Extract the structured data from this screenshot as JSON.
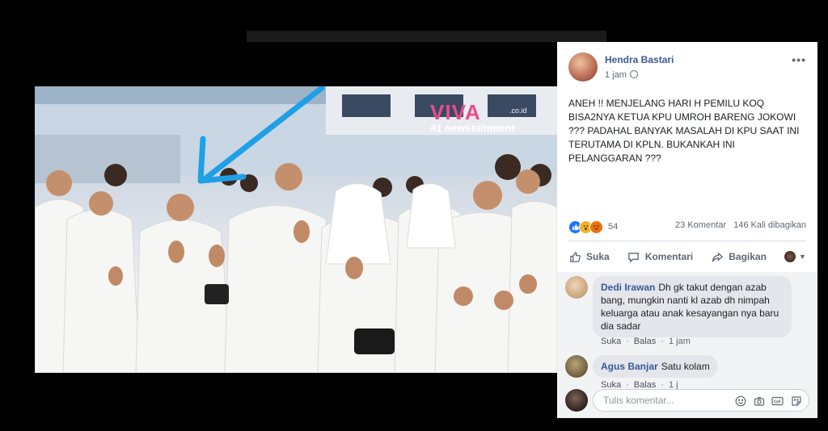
{
  "photo": {
    "watermark_logo": "VIVA",
    "watermark_domain": ".co.id",
    "watermark_tag": "#1 newstainment"
  },
  "post": {
    "author": "Hendra Bastari",
    "time": "1 jam",
    "more_label": "•••",
    "text": "ANEH !! MENJELANG HARI H PEMILU KOQ BISA2NYA KETUA KPU UMROH BARENG JOKOWI ??? PADAHAL BANYAK MASALAH DI KPU SAAT INI TERUTAMA DI KPLN. BUKANKAH INI PELANGGARAN ???",
    "reaction_count": "54",
    "comments_count": "23 Komentar",
    "shares_count": "146 Kali dibagikan"
  },
  "actions": {
    "like": "Suka",
    "comment": "Komentari",
    "share": "Bagikan"
  },
  "comments": [
    {
      "author": "Dedi Irawan",
      "text": "Dh gk takut dengan azab bang, mungkin nanti kl azab dh nimpah keluarga atau anak kesayangan nya baru dia sadar",
      "like": "Suka",
      "reply": "Balas",
      "time": "1 jam"
    },
    {
      "author": "Agus Banjar",
      "text": "Satu kolam",
      "like": "Suka",
      "reply": "Balas",
      "time": "1 j"
    }
  ],
  "composer": {
    "placeholder": "Tulis komentar..."
  },
  "colors": {
    "link_blue": "#385898",
    "like_blue": "#1877f2",
    "panel_bg": "#ffffff",
    "comment_bg": "#f2f3f5",
    "arrow": "#1fa0e6"
  }
}
